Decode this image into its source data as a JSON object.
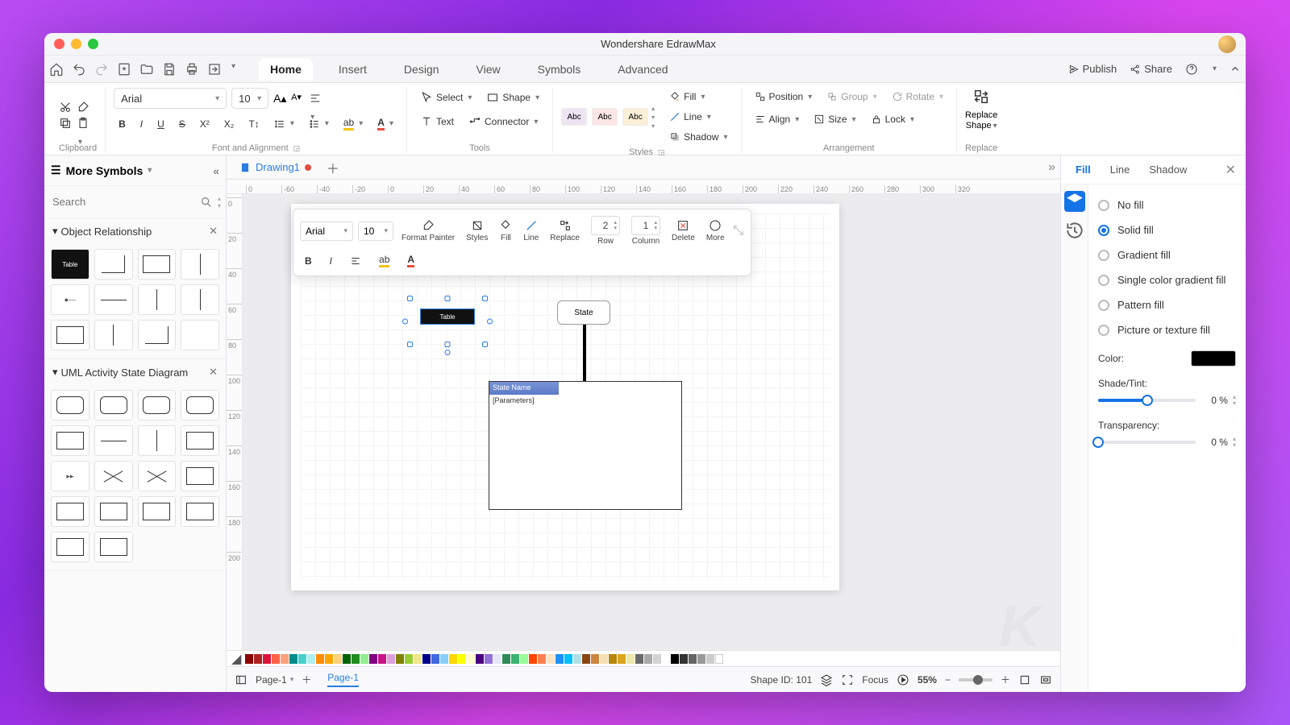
{
  "app": {
    "title": "Wondershare EdrawMax"
  },
  "quick": {
    "publish": "Publish",
    "share": "Share"
  },
  "tabs": {
    "home": "Home",
    "insert": "Insert",
    "design": "Design",
    "view": "View",
    "symbols": "Symbols",
    "advanced": "Advanced"
  },
  "ribbon": {
    "clipboard": "Clipboard",
    "fontAlign": "Font and Alignment",
    "tools": "Tools",
    "styles": "Styles",
    "arrangement": "Arrangement",
    "replace": "Replace",
    "font": "Arial",
    "size": "10",
    "select": "Select",
    "shape": "Shape",
    "text": "Text",
    "connector": "Connector",
    "fill": "Fill",
    "line": "Line",
    "shadow": "Shadow",
    "position": "Position",
    "group": "Group",
    "rotate": "Rotate",
    "align": "Align",
    "sizeBtn": "Size",
    "lock": "Lock",
    "replaceShape": "Replace\nShape",
    "abc": "Abc"
  },
  "left": {
    "title": "More Symbols",
    "searchPlaceholder": "Search",
    "sec1": "Object Relationship",
    "sec2": "UML Activity State Diagram"
  },
  "doc": {
    "tab": "Drawing1"
  },
  "rulerH": [
    "0",
    "-60",
    "-20",
    "20",
    "60",
    "100",
    "140",
    "180",
    "220",
    "260",
    "300"
  ],
  "rulerHExtra": [
    "-40",
    "40",
    "80",
    "120",
    "160",
    "200",
    "240",
    "280",
    "320"
  ],
  "rulerV": [
    "0",
    "20",
    "40",
    "60",
    "80",
    "100",
    "120",
    "140",
    "160",
    "180",
    "200"
  ],
  "floatTb": {
    "font": "Arial",
    "size": "10",
    "formatPainter": "Format Painter",
    "styles": "Styles",
    "fill": "Fill",
    "line": "Line",
    "replace": "Replace",
    "row": "Row",
    "col": "Column",
    "delete": "Delete",
    "more": "More",
    "rowN": "2",
    "colN": "1"
  },
  "canvas": {
    "tableLabel": "Table",
    "stateLabel": "State",
    "boxHeader": "State Name",
    "boxParam": "[Parameters]"
  },
  "rightPanel": {
    "tabFill": "Fill",
    "tabLine": "Line",
    "tabShadow": "Shadow",
    "noFill": "No fill",
    "solid": "Solid fill",
    "gradient": "Gradient fill",
    "singleGradient": "Single color gradient fill",
    "pattern": "Pattern fill",
    "picture": "Picture or texture fill",
    "colorLabel": "Color:",
    "shadeLabel": "Shade/Tint:",
    "transLabel": "Transparency:",
    "shadeVal": "0 %",
    "transVal": "0 %"
  },
  "status": {
    "pageDropdown": "Page-1",
    "pageTab": "Page-1",
    "shapeId": "Shape ID: 101",
    "focus": "Focus",
    "zoom": "55%"
  }
}
